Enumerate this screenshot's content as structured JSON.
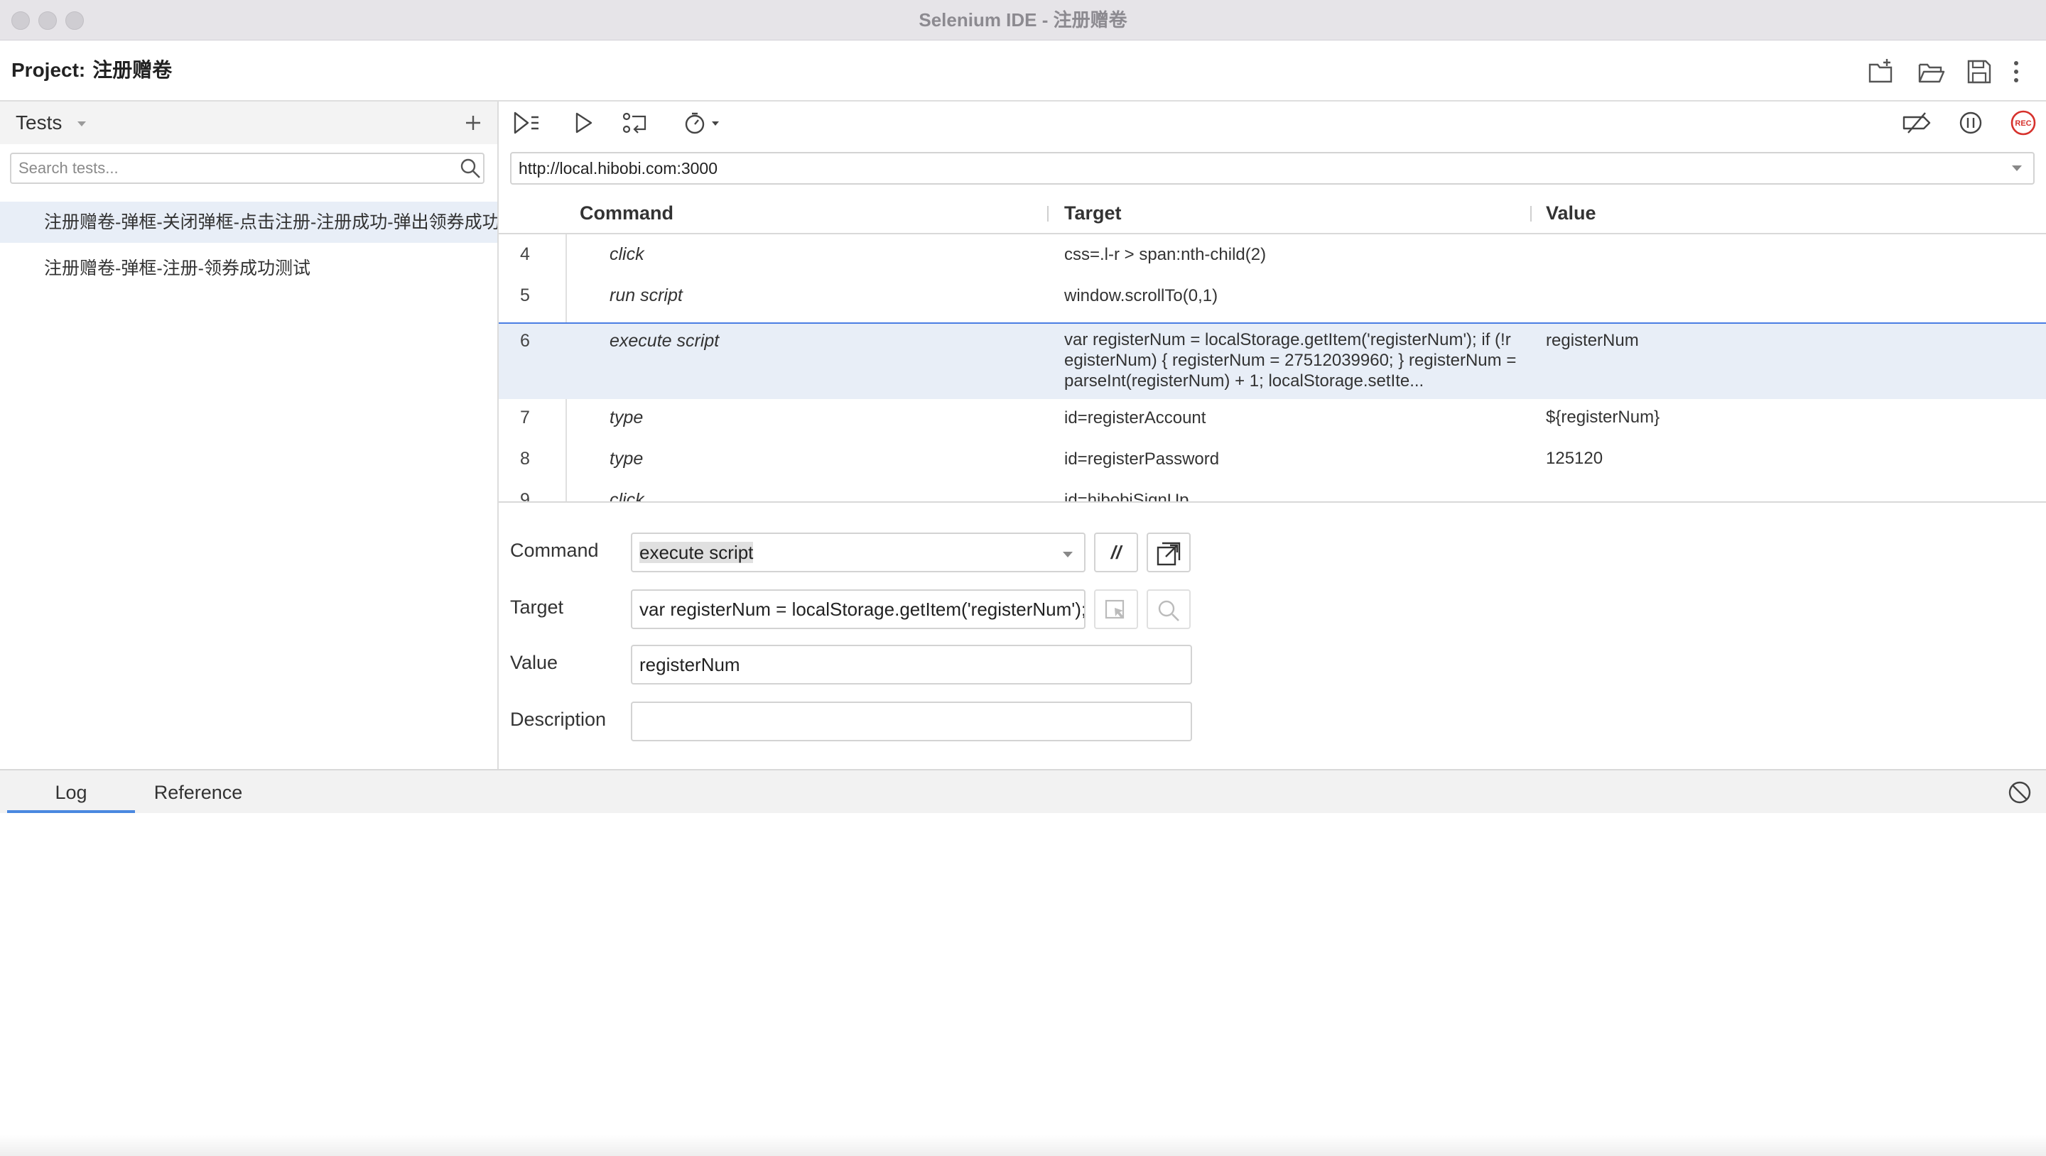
{
  "window": {
    "title": "Selenium IDE - 注册赠卷"
  },
  "project": {
    "label": "Project:",
    "name": "注册赠卷"
  },
  "tests_panel": {
    "title": "Tests",
    "search_placeholder": "Search tests...",
    "items": [
      {
        "label": "注册赠卷-弹框-关闭弹框-点击注册-注册成功-弹出领券成功",
        "selected": true
      },
      {
        "label": "注册赠卷-弹框-注册-领券成功测试",
        "selected": false
      }
    ]
  },
  "url_bar": {
    "value": "http://local.hibobi.com:3000"
  },
  "table": {
    "headers": {
      "command": "Command",
      "target": "Target",
      "value": "Value"
    },
    "rows": [
      {
        "num": "4",
        "command": "click",
        "target": "css=.l-r > span:nth-child(2)",
        "value": ""
      },
      {
        "num": "5",
        "command": "run script",
        "target": "window.scrollTo(0,1)",
        "value": ""
      },
      {
        "num": "6",
        "command": "execute script",
        "target": "var registerNum = localStorage.getItem('registerNum'); if (!registerNum) { registerNum = 27512039960; } registerNum = parseInt(registerNum) + 1; localStorage.setIte...",
        "value": "registerNum",
        "selected": true
      },
      {
        "num": "7",
        "command": "type",
        "target": "id=registerAccount",
        "value": "${registerNum}"
      },
      {
        "num": "8",
        "command": "type",
        "target": "id=registerPassword",
        "value": "125120"
      },
      {
        "num": "9",
        "command": "click",
        "target": "id=hibobiSignUp",
        "value": ""
      }
    ]
  },
  "editor": {
    "command_label": "Command",
    "command_value": "execute script",
    "comment_button": "//",
    "target_label": "Target",
    "target_value": "var registerNum = localStorage.getItem('registerNum');",
    "value_label": "Value",
    "value_value": "registerNum",
    "description_label": "Description",
    "description_value": ""
  },
  "log_panel": {
    "tabs": [
      "Log",
      "Reference"
    ],
    "active_tab": "Log"
  },
  "colors": {
    "selection_bg": "#e8eef7",
    "selection_border": "#4a7de3",
    "record_red": "#d6312c",
    "tab_underline": "#4a88e0"
  },
  "icons": {
    "header": [
      "new-project-icon",
      "open-project-icon",
      "save-project-icon",
      "more-options-icon"
    ],
    "toolbar": [
      "run-all-icon",
      "run-test-icon",
      "step-over-icon",
      "speed-icon",
      "disable-breakpoints-icon",
      "pause-icon",
      "record-icon"
    ]
  }
}
